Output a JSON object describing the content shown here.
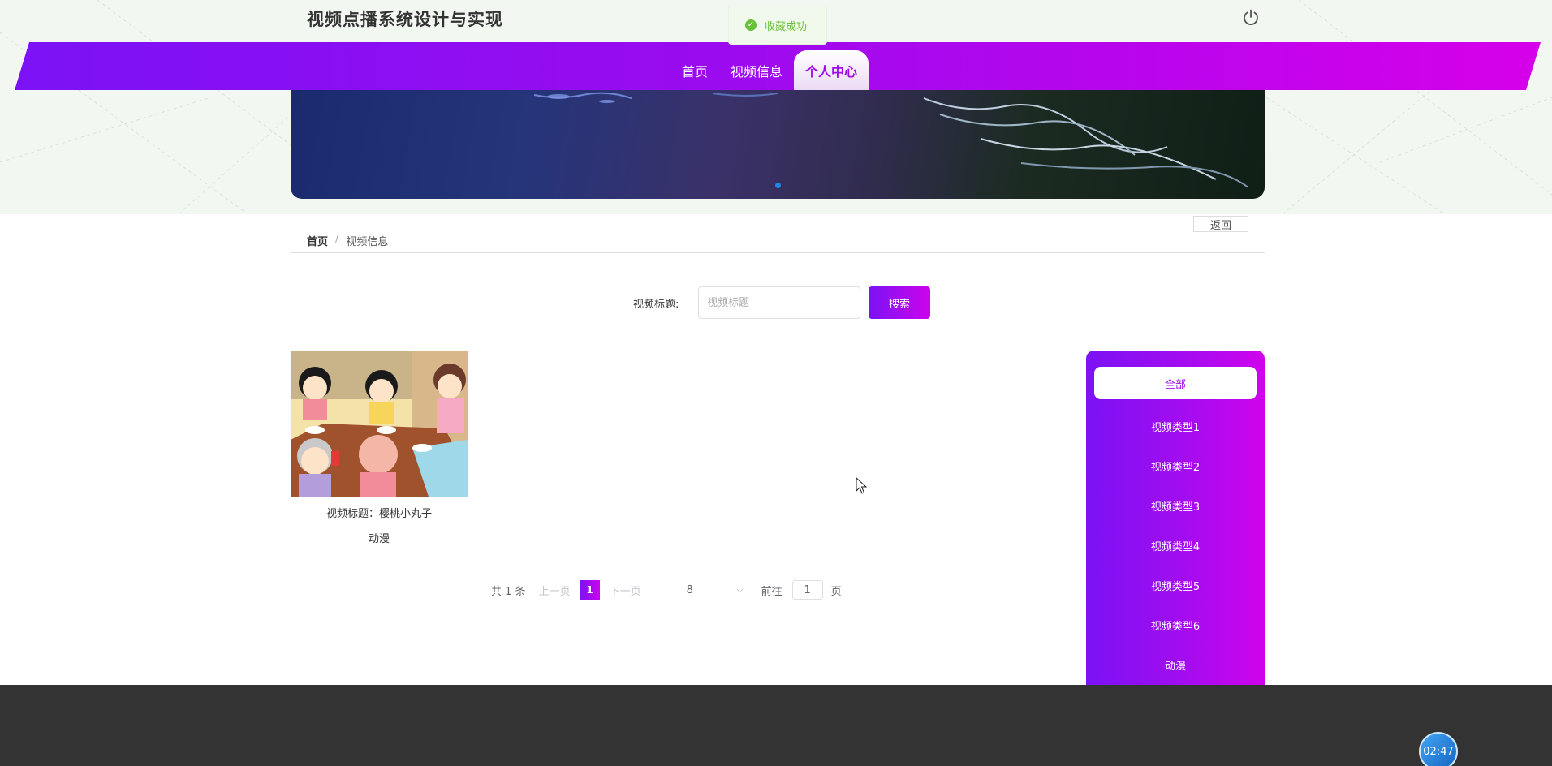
{
  "site": {
    "title": "视频点播系统设计与实现"
  },
  "toast": {
    "message": "收藏成功"
  },
  "nav": {
    "items": [
      {
        "label": "首页"
      },
      {
        "label": "视频信息"
      },
      {
        "label": "个人中心"
      }
    ],
    "active": "个人中心"
  },
  "breadcrumb": {
    "home": "首页",
    "separator": "/",
    "current": "视频信息"
  },
  "back_label": "返回",
  "search": {
    "label": "视频标题:",
    "placeholder": "视频标题",
    "button": "搜索"
  },
  "videos": [
    {
      "title": "视频标题：樱桃小丸子",
      "type": "动漫"
    }
  ],
  "pagination": {
    "total": "共 1 条",
    "prev": "上一页",
    "current": "1",
    "next": "下一页",
    "page_size": "8",
    "goto": "前往",
    "goto_value": "1",
    "page_unit": "页"
  },
  "categories": [
    {
      "label": "全部"
    },
    {
      "label": "视频类型1"
    },
    {
      "label": "视频类型2"
    },
    {
      "label": "视频类型3"
    },
    {
      "label": "视频类型4"
    },
    {
      "label": "视频类型5"
    },
    {
      "label": "视频类型6"
    },
    {
      "label": "动漫"
    }
  ],
  "timer": "02:47",
  "icons": {
    "power": "power-icon",
    "toast": "check-circle-icon",
    "dropdown": "chevron-down-icon",
    "cursor": "mouse-cursor-icon"
  },
  "colors": {
    "accent_start": "#7b12f5",
    "accent_end": "#d600ea",
    "success": "#67c23a",
    "footer": "#333333"
  }
}
